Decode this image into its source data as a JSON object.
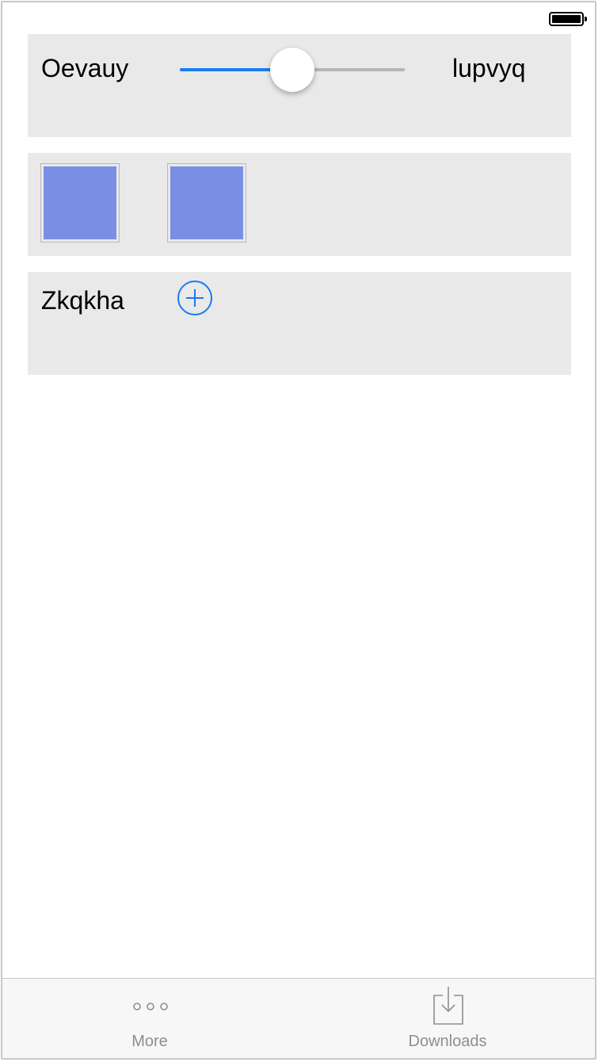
{
  "status_bar": {
    "battery_level": 1.0
  },
  "slider_row": {
    "min_label": "Oevauy",
    "max_label": "lupvyq",
    "value": 0.5
  },
  "swatch_row": {
    "swatches": [
      {
        "color": "#7a8fe3"
      },
      {
        "color": "#7a8fe3"
      }
    ]
  },
  "add_row": {
    "label": "Zkqkha"
  },
  "tab_bar": {
    "items": [
      {
        "label": "More",
        "icon": "more-icon"
      },
      {
        "label": "Downloads",
        "icon": "downloads-icon"
      }
    ]
  },
  "colors": {
    "accent": "#1a7bf2",
    "panel_background": "#e9e9e9",
    "tab_label": "#8e8e8e"
  }
}
